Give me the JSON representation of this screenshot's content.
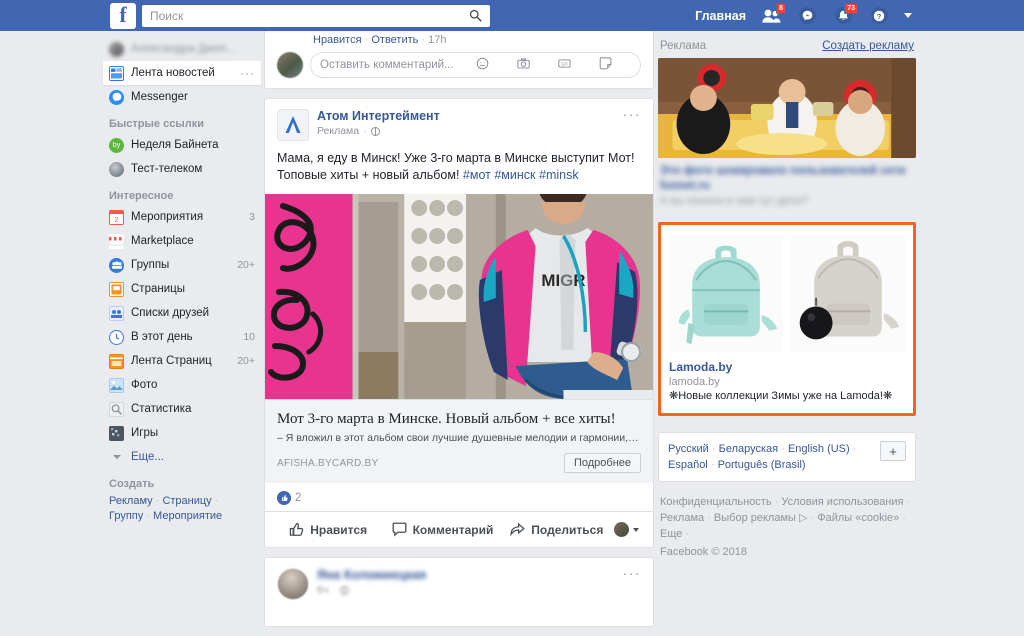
{
  "topbar": {
    "logo": "f",
    "search": {
      "placeholder": "Поиск",
      "value": "",
      "icon": "search-icon"
    },
    "home_label": "Главная",
    "friends_icon": "friends-icon",
    "friends_badge": "8",
    "messenger_icon": "messenger-icon",
    "notifications_icon": "notifications-bell-icon",
    "notifications_badge": "73",
    "help_icon": "help-question-icon",
    "account_caret_icon": "chevron-down-icon"
  },
  "sidebar": {
    "profile": {
      "label": "Александра Джеп...",
      "icon": "avatar"
    },
    "items": [
      {
        "label": "Лента новостей",
        "icon": "news-feed-icon",
        "color": "#4080ff",
        "count": "",
        "active": true,
        "dots": "···"
      },
      {
        "label": "Messenger",
        "icon": "messenger-icon",
        "color": "#2c8cff",
        "count": "",
        "round": true
      }
    ],
    "quick_links_head": "Быстрые ссылки",
    "quick_links": [
      {
        "label": "Неделя Байнета",
        "icon": "page-avatar-icon",
        "color": "#5ab83c",
        "round": true,
        "count": ""
      },
      {
        "label": "Тест-телеком",
        "icon": "page-avatar-icon",
        "color": "#7d8794",
        "round": true,
        "count": ""
      }
    ],
    "interesting_head": "Интересное",
    "interesting": [
      {
        "label": "Мероприятия",
        "icon": "calendar-icon",
        "color": "#f0584a",
        "count": "3"
      },
      {
        "label": "Marketplace",
        "icon": "marketplace-icon",
        "color": "#f0584a",
        "count": ""
      },
      {
        "label": "Группы",
        "icon": "groups-icon",
        "color": "#3578e5",
        "count": "20+",
        "round": true
      },
      {
        "label": "Страницы",
        "icon": "pages-icon",
        "color": "#f7921e",
        "count": ""
      },
      {
        "label": "Списки друзей",
        "icon": "friend-lists-icon",
        "color": "#3578e5",
        "count": ""
      },
      {
        "label": "В этот день",
        "icon": "on-this-day-icon",
        "color": "#3578e5",
        "count": "10",
        "round": true
      },
      {
        "label": "Лента Страниц",
        "icon": "pages-feed-icon",
        "color": "#f7921e",
        "count": "20+"
      },
      {
        "label": "Фото",
        "icon": "photo-icon",
        "color": "#7bb7e0",
        "count": ""
      },
      {
        "label": "Статистика",
        "icon": "insights-icon",
        "color": "#8d949e",
        "count": ""
      },
      {
        "label": "Игры",
        "icon": "games-icon",
        "color": "#4b5460",
        "count": ""
      }
    ],
    "more_label": "Еще...",
    "more_caret_icon": "chevron-down-icon",
    "create_head": "Создать",
    "create_links": [
      "Рекламу",
      "Страницу",
      "Группу",
      "Мероприятие"
    ]
  },
  "feed": {
    "comment_tail": {
      "like_label": "Нравится",
      "reply_label": "Ответить",
      "time": "17h",
      "input_placeholder": "Оставить комментарий...",
      "icons": [
        "emoji-icon",
        "camera-icon",
        "gif-icon",
        "sticker-icon"
      ]
    },
    "post": {
      "page_name": "Атом Интертеймент",
      "page_avatar_icon": "atom-logo-icon",
      "sponsored_label": "Реклама",
      "privacy_icon": "globe-icon",
      "menu_icon": "more-options-icon",
      "text_plain": "Мама, я еду в Минск! Уже 3-го марта в Минске выступит Мот! Топовые хиты + новый альбом! ",
      "hashtags": [
        "#мот",
        "#минск",
        "#minsk"
      ],
      "image_alt": "Парень в розово-синей ветровке у стены с граффити",
      "link_title": "Мот 3-го марта в Минске. Новый альбом + все хиты!",
      "link_desc": "– Я вложил в этот альбом свои лучшие душевные мелодии и гармонии, тольк...",
      "link_domain": "AFISHA.BYCARD.BY",
      "link_button": "Подробнее",
      "reactions_count": "2",
      "reaction_icon": "like-thumb-icon",
      "actions": [
        {
          "label": "Нравится",
          "icon": "thumbs-up-icon"
        },
        {
          "label": "Комментарий",
          "icon": "comment-bubble-icon"
        },
        {
          "label": "Поделиться",
          "icon": "share-arrow-icon"
        }
      ],
      "share_avatar_icon": "avatar",
      "share_caret_icon": "chevron-down-icon"
    },
    "next_post": {
      "author": "Яна Коломиецкая",
      "meta": "6ч",
      "privacy_icon": "globe-icon",
      "menu_icon": "more-options-icon",
      "avatar_icon": "avatar"
    }
  },
  "right_column": {
    "ad_header": {
      "title": "Реклама",
      "create_link": "Создать рекламу"
    },
    "ad_one": {
      "image_alt": "Люди за столом в национальных костюмах",
      "title": "Это фото шокировало пользователей сети funnet.ru",
      "subtitle": "А вы поняли в чем тут дело?"
    },
    "ad_two": {
      "image_alt": "Два рюкзака: мятный и серый",
      "name": "Lamoda.by",
      "url": "lamoda.by",
      "description": "❋Новые коллекции Зимы уже на Lamoda!❋",
      "highlight_color": "#f26522"
    },
    "languages": [
      "Русский",
      "Беларуская",
      "English (US)",
      "Español",
      "Português (Brasil)"
    ],
    "lang_more_button": "+",
    "footer_links": [
      "Конфиденциальность",
      "Условия использования",
      "Реклама",
      "Выбор рекламы",
      "Файлы «cookie»",
      "Еще"
    ],
    "ad_choices_icon": "ad-choices-icon",
    "copyright": "Facebook © 2018"
  },
  "colors": {
    "fb_blue": "#4267B2",
    "page_bg": "#e9ebee",
    "link": "#365899",
    "muted": "#90949c",
    "highlight_orange": "#f26522"
  }
}
